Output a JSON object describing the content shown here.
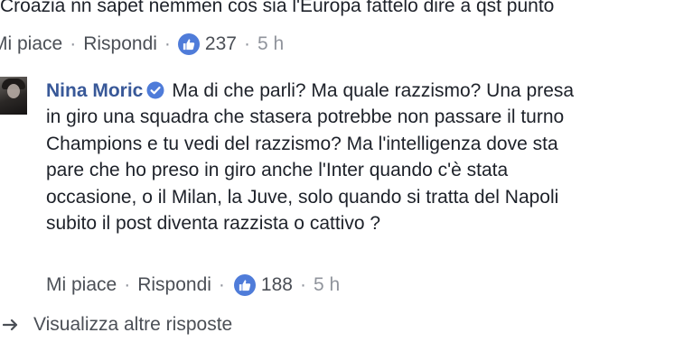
{
  "top_comment": {
    "text": "Croazia nn sapet nemmen cos sia l'Europa fattelo dire a qst punto",
    "actions": {
      "like_label": "Mi piace",
      "reply_label": "Rispondi",
      "separator": "·",
      "like_count": "237",
      "time": "5 h"
    }
  },
  "reply": {
    "author": "Nina Moric",
    "lines": [
      "Ma di che parli? Ma quale razzismo? Una presa",
      "in giro una squadra che stasera potrebbe non passare il turno",
      "Champions e tu vedi del razzismo? Ma l'intelligenza dove sta",
      "pare che ho preso in giro anche l'Inter quando c'è stata",
      "occasione, o il Milan, la Juve, solo quando si tratta del Napoli",
      "subito il post diventa razzista o cattivo ?"
    ],
    "actions": {
      "like_label": "Mi piace",
      "reply_label": "Rispondi",
      "separator": "·",
      "like_count": "188",
      "time": "5 h"
    }
  },
  "more_replies": {
    "label": "Visualizza altre risposte"
  },
  "icons": {
    "like": "thumbs-up-icon",
    "verified": "verified-badge-icon",
    "more": "reply-arrow-icon"
  },
  "colors": {
    "author": "#385898",
    "like_badge": "#4f7cd9",
    "text": "#1d2129",
    "meta": "#90949c"
  }
}
